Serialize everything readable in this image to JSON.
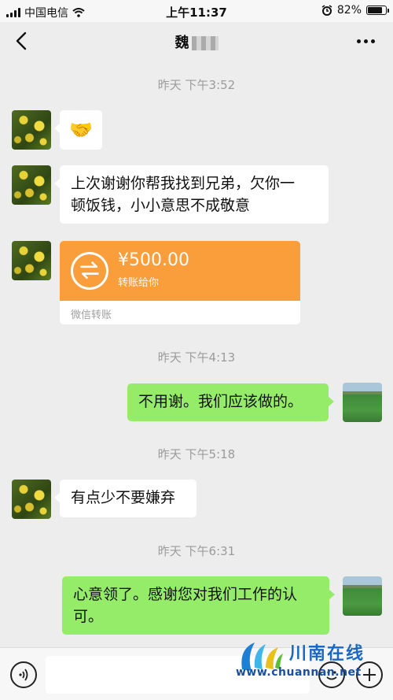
{
  "status_bar": {
    "carrier": "中国电信",
    "time": "上午11:37",
    "battery": "82%",
    "battery_level": 0.82
  },
  "nav": {
    "title": "魏"
  },
  "messages": [
    {
      "timestamp": "昨天 下午3:52"
    },
    {
      "sender": "contact",
      "type": "emoji",
      "emoji": "🤝"
    },
    {
      "sender": "contact",
      "type": "text",
      "lines": [
        "上次谢谢你帮我找到兄弟，欠你一",
        "顿饭钱，小小意思不成敬意"
      ]
    },
    {
      "sender": "contact",
      "type": "transfer",
      "amount": "¥500.00",
      "subtitle": "转账给你",
      "footer": "微信转账"
    },
    {
      "timestamp": "昨天 下午4:13"
    },
    {
      "sender": "me",
      "type": "text",
      "lines": [
        "不用谢。我们应该做的。"
      ]
    },
    {
      "timestamp": "昨天 下午5:18"
    },
    {
      "sender": "contact",
      "type": "text",
      "lines": [
        "有点少不要嫌弃"
      ]
    },
    {
      "timestamp": "昨天 下午6:31"
    },
    {
      "sender": "me",
      "type": "text",
      "lines": [
        "心意领了。感谢您对我们工作的认",
        "可。"
      ]
    }
  ],
  "watermark": {
    "name": "川南在线",
    "url": "www.chuannan.net"
  },
  "colors": {
    "background": "#ededed",
    "my_bubble": "#95ec69",
    "their_bubble": "#ffffff",
    "transfer": "#fa9d3b",
    "timestamp": "#9b9b9b"
  }
}
